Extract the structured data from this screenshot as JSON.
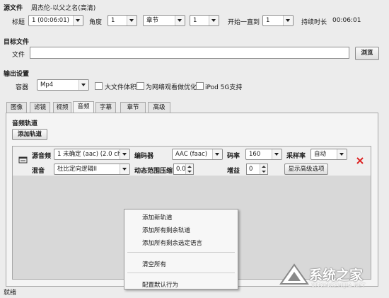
{
  "source": {
    "section_label": "源文件",
    "file_name": "周杰伦-以父之名(高清)",
    "title_label": "标题",
    "title_value": "1 (00:06:01)",
    "angle_label": "角度",
    "angle_value": "1",
    "range_type": "章节",
    "range_start": "1",
    "range_to_label": "开始一直到",
    "range_end": "1",
    "duration_label": "持续时长",
    "duration_value": "00:06:01"
  },
  "target": {
    "section_label": "目标文件",
    "file_label": "文件",
    "file_value": "",
    "browse_label": "浏览"
  },
  "output": {
    "section_label": "输出设置",
    "container_label": "容器",
    "container_value": "Mp4",
    "large_file_label": "大文件体积",
    "web_optimize_label": "为网络观看做优化",
    "ipod_label": "iPod 5G支持"
  },
  "tabs": [
    "图像",
    "滤镜",
    "视频",
    "音频",
    "字幕",
    "章节",
    "高级"
  ],
  "active_tab": "音频",
  "audio": {
    "tracks_label": "音频轨道",
    "add_track_label": "添加轨道",
    "source_label": "源音频",
    "source_value": "1 未确定 (aac) (2.0 ch)",
    "encoder_label": "编码器",
    "encoder_value": "AAC (faac)",
    "bitrate_label": "码率",
    "bitrate_value": "160",
    "samplerate_label": "采样率",
    "samplerate_value": "自动",
    "mixdown_label": "混音",
    "mixdown_value": "杜比定向逻辑II",
    "drc_label": "动态范围压缩",
    "drc_value": "0.0",
    "gain_label": "增益",
    "gain_value": "0",
    "advanced_label": "显示高级选项"
  },
  "context_menu": {
    "items": [
      "添加新轨道",
      "添加所有剩余轨道",
      "添加所有剩余选定语言",
      "清空所有",
      "配置默认行为"
    ]
  },
  "status": {
    "text": "就绪"
  },
  "watermark": {
    "brand": "系统之家",
    "url": "XITONGZHIJIA.NET"
  }
}
